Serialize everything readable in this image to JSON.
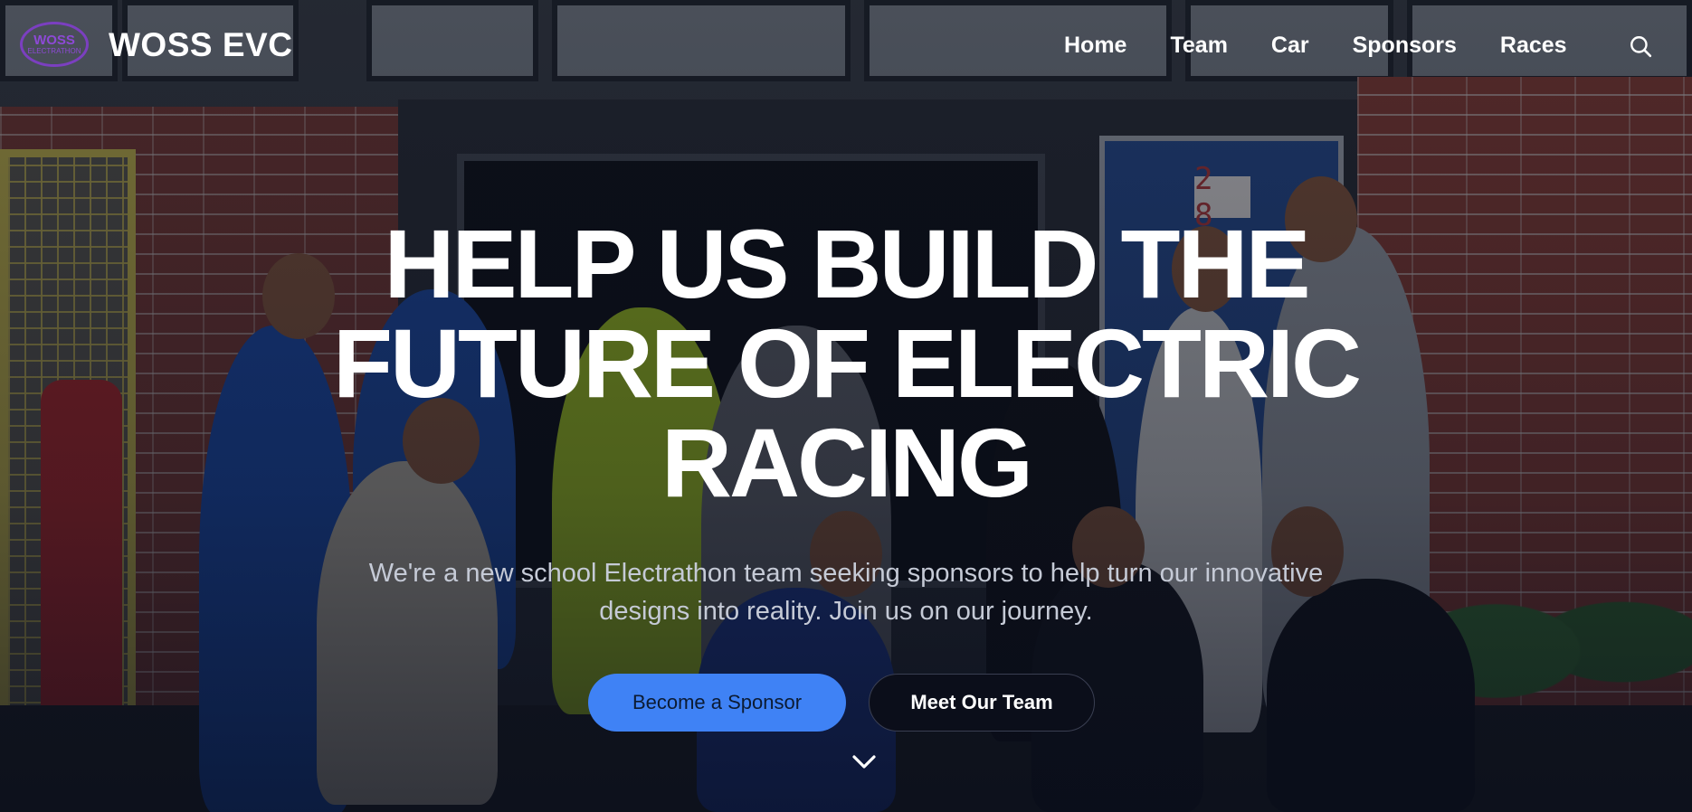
{
  "nav": {
    "logo_text_top": "WOSS",
    "logo_text_bottom": "ELECTRATHON",
    "brand": "WOSS EVC",
    "items": [
      {
        "label": "Home"
      },
      {
        "label": "Team"
      },
      {
        "label": "Car"
      },
      {
        "label": "Sponsors"
      },
      {
        "label": "Races"
      }
    ],
    "search_icon": "search-icon"
  },
  "background": {
    "door_number": "2 8"
  },
  "hero": {
    "headline": "HELP US BUILD THE FUTURE OF ELECTRIC RACING",
    "subtitle": "We're a new school Electrathon team seeking sponsors to help turn our innovative designs into reality. Join us on our journey.",
    "primary_button": "Become a Sponsor",
    "secondary_button": "Meet Our Team",
    "scroll_icon": "chevron-down-icon"
  },
  "colors": {
    "accent": "#3f82f5",
    "logo": "#7b3fc0",
    "secondary_button_bg": "#0b0e1a"
  }
}
